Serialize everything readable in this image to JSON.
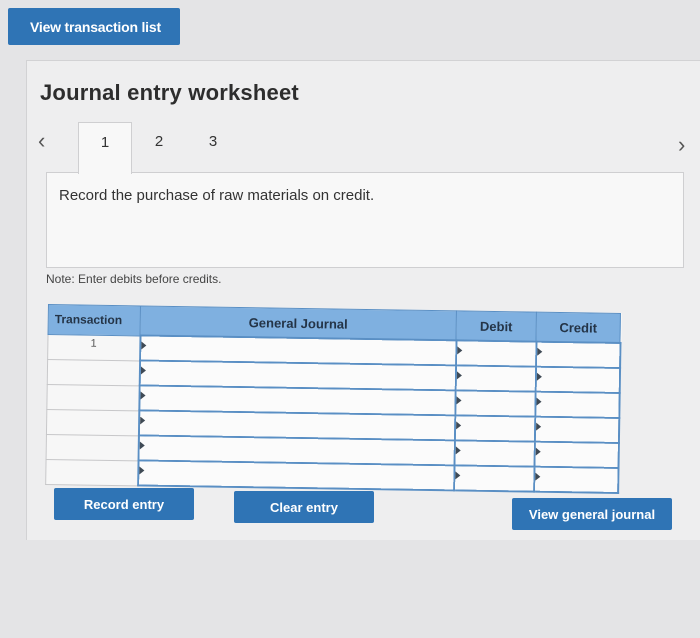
{
  "top_button": {
    "label": "View transaction list"
  },
  "worksheet": {
    "title": "Journal entry worksheet",
    "tabs": [
      {
        "label": "1",
        "active": true
      },
      {
        "label": "2",
        "active": false
      },
      {
        "label": "3",
        "active": false
      }
    ],
    "nav": {
      "prev_icon": "chevron-left-icon",
      "next_icon": "chevron-right-icon"
    },
    "instruction": "Record the purchase of raw materials on credit.",
    "note": "Note: Enter debits before credits."
  },
  "journal_table": {
    "headers": {
      "transaction": "Transaction",
      "general_journal": "General Journal",
      "debit": "Debit",
      "credit": "Credit"
    },
    "rows": [
      {
        "transaction": "1",
        "account": "",
        "debit": "",
        "credit": ""
      },
      {
        "transaction": "",
        "account": "",
        "debit": "",
        "credit": ""
      },
      {
        "transaction": "",
        "account": "",
        "debit": "",
        "credit": ""
      },
      {
        "transaction": "",
        "account": "",
        "debit": "",
        "credit": ""
      },
      {
        "transaction": "",
        "account": "",
        "debit": "",
        "credit": ""
      },
      {
        "transaction": "",
        "account": "",
        "debit": "",
        "credit": ""
      }
    ]
  },
  "buttons": {
    "record_entry": "Record entry",
    "clear_entry": "Clear entry",
    "view_general_journal": "View general journal"
  },
  "colors": {
    "button_bg": "#2f74b5",
    "header_bg": "#7fb0e0",
    "input_border": "#5a8fc4"
  }
}
